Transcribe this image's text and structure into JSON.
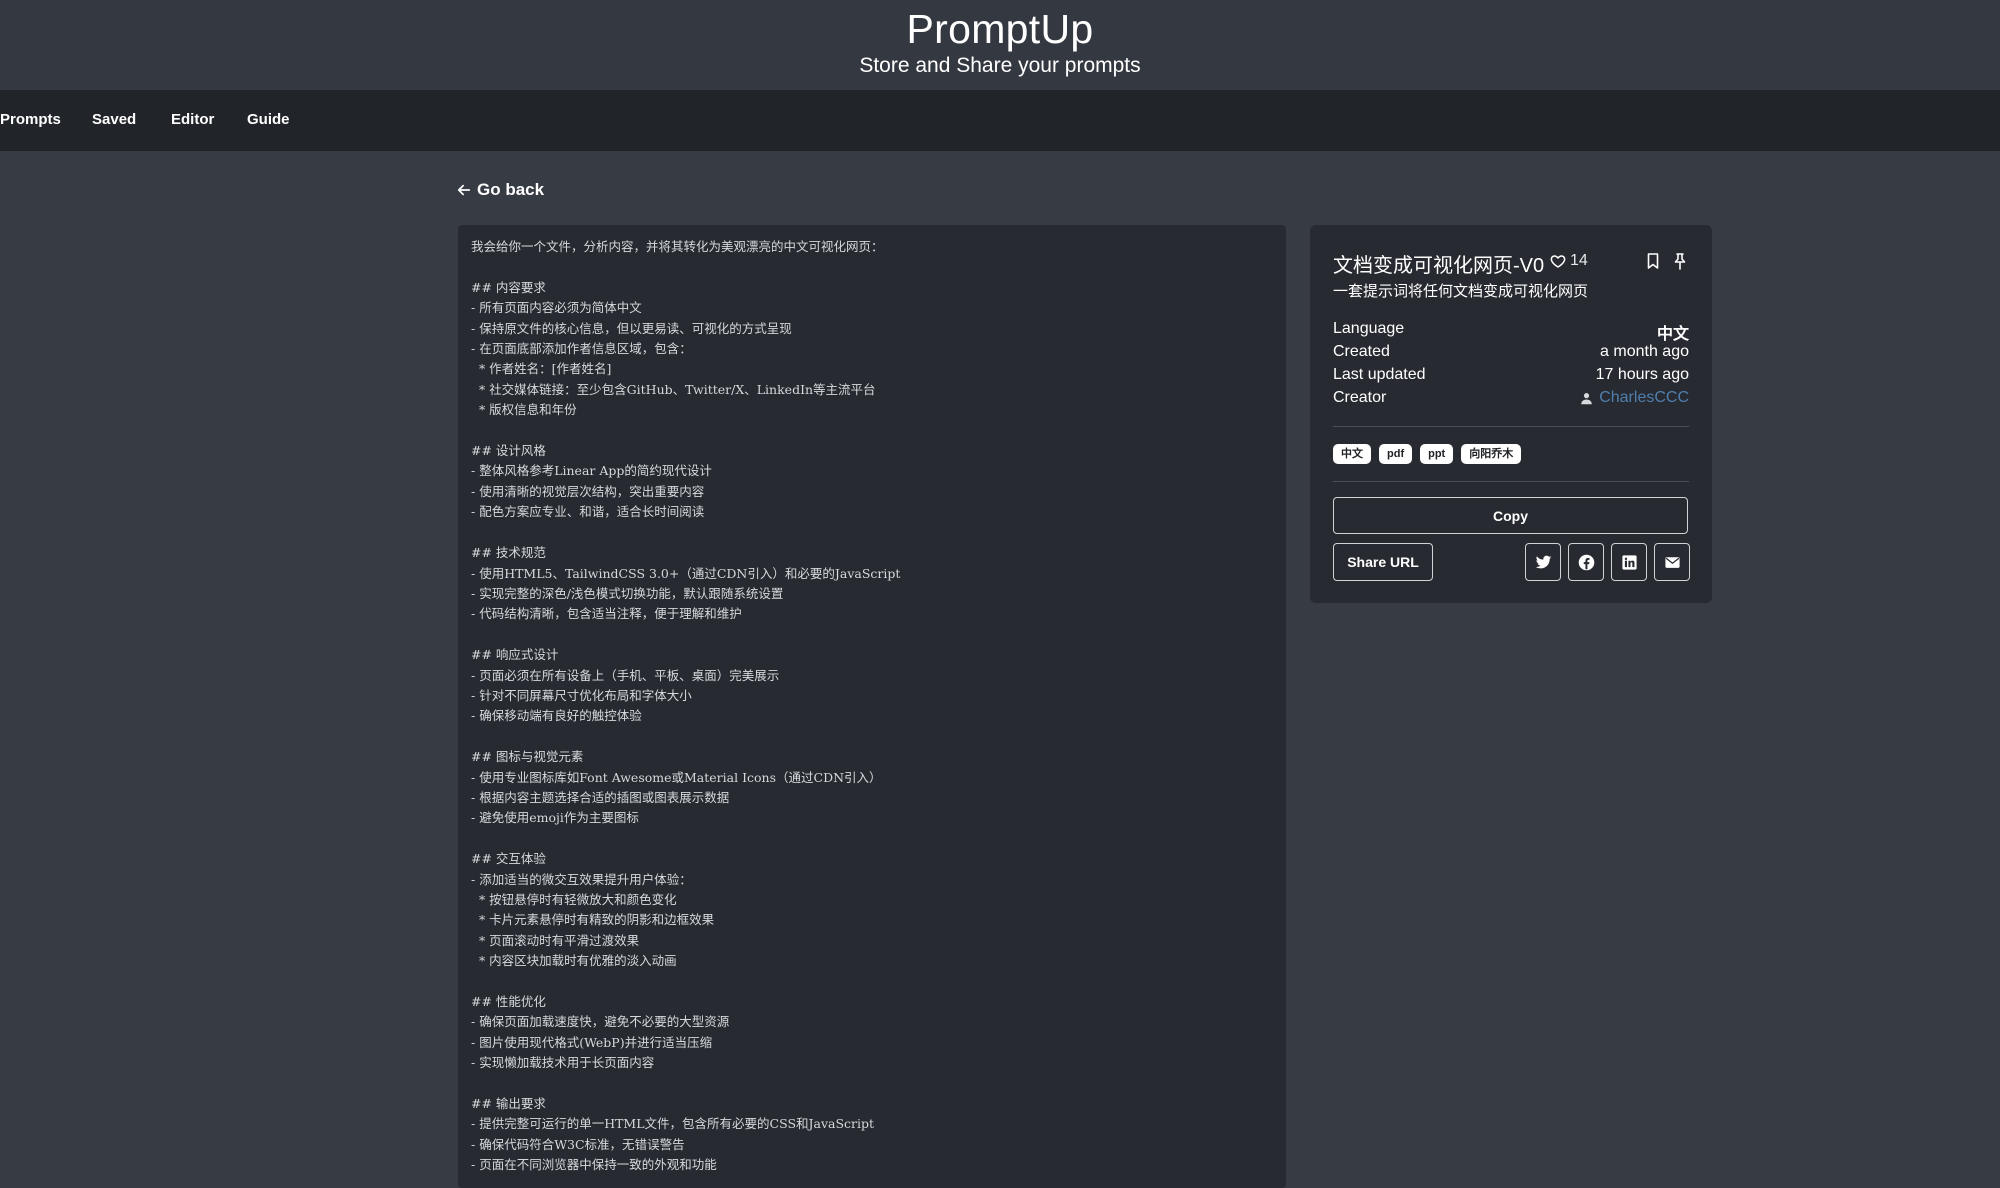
{
  "header": {
    "title": "PromptUp",
    "subtitle": "Store and Share your prompts"
  },
  "nav": {
    "items": [
      {
        "label": "Prompts"
      },
      {
        "label": "Saved"
      },
      {
        "label": "Editor"
      },
      {
        "label": "Guide"
      }
    ]
  },
  "go_back": {
    "label": "Go back",
    "icon": "arrow-left-icon"
  },
  "prompt": {
    "text": "我会给你一个文件，分析内容，并将其转化为美观漂亮的中文可视化网页：\n\n## 内容要求\n- 所有页面内容必须为简体中文\n- 保持原文件的核心信息，但以更易读、可视化的方式呈现\n- 在页面底部添加作者信息区域，包含：\n  * 作者姓名：[作者姓名]\n  * 社交媒体链接：至少包含GitHub、Twitter/X、LinkedIn等主流平台\n  * 版权信息和年份\n\n## 设计风格\n- 整体风格参考Linear App的简约现代设计\n- 使用清晰的视觉层次结构，突出重要内容\n- 配色方案应专业、和谐，适合长时间阅读\n\n## 技术规范\n- 使用HTML5、TailwindCSS 3.0+（通过CDN引入）和必要的JavaScript\n- 实现完整的深色/浅色模式切换功能，默认跟随系统设置\n- 代码结构清晰，包含适当注释，便于理解和维护\n\n## 响应式设计\n- 页面必须在所有设备上（手机、平板、桌面）完美展示\n- 针对不同屏幕尺寸优化布局和字体大小\n- 确保移动端有良好的触控体验\n\n## 图标与视觉元素\n- 使用专业图标库如Font Awesome或Material Icons（通过CDN引入）\n- 根据内容主题选择合适的插图或图表展示数据\n- 避免使用emoji作为主要图标\n\n## 交互体验\n- 添加适当的微交互效果提升用户体验：\n  * 按钮悬停时有轻微放大和颜色变化\n  * 卡片元素悬停时有精致的阴影和边框效果\n  * 页面滚动时有平滑过渡效果\n  * 内容区块加载时有优雅的淡入动画\n\n## 性能优化\n- 确保页面加载速度快，避免不必要的大型资源\n- 图片使用现代格式(WebP)并进行适当压缩\n- 实现懒加载技术用于长页面内容\n\n## 输出要求\n- 提供完整可运行的单一HTML文件，包含所有必要的CSS和JavaScript\n- 确保代码符合W3C标准，无错误警告\n- 页面在不同浏览器中保持一致的外观和功能"
  },
  "card": {
    "title": "文档变成可视化网页-V0",
    "likes": "14",
    "description": "一套提示词将任何文档变成可视化网页",
    "meta": [
      {
        "label": "Language",
        "value": "中文"
      },
      {
        "label": "Created",
        "value": "a month ago"
      },
      {
        "label": "Last updated",
        "value": "17 hours ago"
      },
      {
        "label": "Creator",
        "value": "CharlesCCC"
      }
    ],
    "tags": [
      "中文",
      "pdf",
      "ppt",
      "向阳乔木"
    ],
    "copy_label": "Copy",
    "share_url_label": "Share URL",
    "social": [
      "twitter-icon",
      "facebook-icon",
      "linkedin-icon",
      "mail-icon"
    ]
  },
  "colors": {
    "background": "#373b43",
    "nav_background": "#212429",
    "panel_background": "#272a30",
    "link": "#4f7fae"
  }
}
